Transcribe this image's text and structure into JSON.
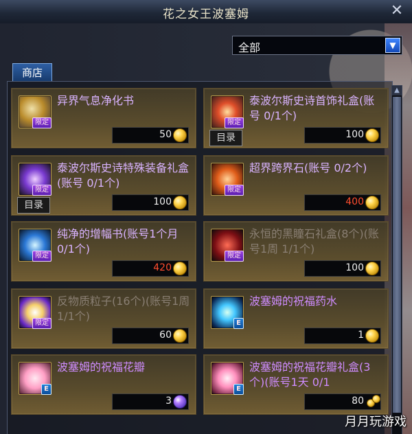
{
  "window": {
    "title": "花之女王波塞姆"
  },
  "filter": {
    "selected": "全部"
  },
  "tabs": [
    {
      "label": "商店"
    }
  ],
  "items": [
    {
      "name": "异界气息净化书",
      "price": "50",
      "badge": "限定",
      "catalog": "",
      "price_style": "normal",
      "currency": "gold-coin",
      "dim": false
    },
    {
      "name": "泰波尔斯史诗首饰礼盒(账号 0/1个)",
      "price": "100",
      "badge": "限定",
      "catalog": "目录",
      "price_style": "normal",
      "currency": "gold-coin",
      "dim": false
    },
    {
      "name": "泰波尔斯史诗特殊装备礼盒(账号 0/1个)",
      "price": "100",
      "badge": "限定",
      "catalog": "目录",
      "price_style": "normal",
      "currency": "gold-coin",
      "dim": false
    },
    {
      "name": "超界跨界石(账号 0/2个)",
      "price": "400",
      "badge": "限定",
      "catalog": "",
      "price_style": "red",
      "currency": "gold-coin",
      "dim": false
    },
    {
      "name": "纯净的增幅书(账号1个月 0/1个)",
      "price": "420",
      "badge": "限定",
      "catalog": "",
      "price_style": "red",
      "currency": "gold-coin",
      "dim": false
    },
    {
      "name": "永恒的黑瞳石礼盒(8个)(账号1周 1/1个)",
      "price": "100",
      "badge": "限定",
      "catalog": "",
      "price_style": "normal",
      "currency": "gold-coin",
      "dim": true
    },
    {
      "name": "反物质粒子(16个)(账号1周 1/1个)",
      "price": "60",
      "badge": "限定",
      "catalog": "",
      "price_style": "normal",
      "currency": "gold-coin",
      "dim": true
    },
    {
      "name": "波塞姆的祝福药水",
      "price": "1",
      "badge": "E",
      "catalog": "",
      "price_style": "normal",
      "currency": "gold-coin",
      "dim": false
    },
    {
      "name": "波塞姆的祝福花瓣",
      "price": "3",
      "badge": "E",
      "catalog": "",
      "price_style": "normal",
      "currency": "purple-coin",
      "dim": false
    },
    {
      "name": "波塞姆的祝福花瓣礼盒(3个)(账号1天 0/1",
      "price": "80",
      "badge": "E",
      "catalog": "",
      "price_style": "normal",
      "currency": "gold-coin-cluster",
      "dim": false
    }
  ],
  "watermark": "月月玩游戏",
  "colors": {
    "item_name": "#d9b3ff",
    "item_name_dim": "#8a7f73",
    "price_red": "#ff4d2e",
    "tab_blue": "#2e5fa3"
  }
}
